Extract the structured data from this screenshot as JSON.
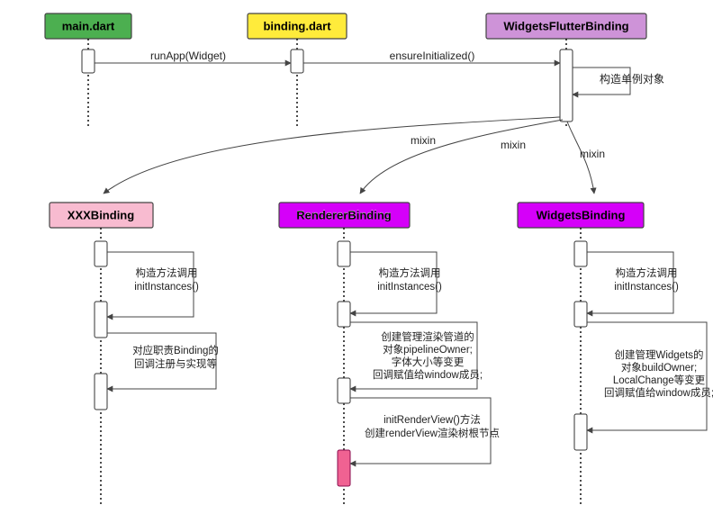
{
  "participants": {
    "main": {
      "label": "main.dart",
      "fill": "#4CAF50"
    },
    "binding": {
      "label": "binding.dart",
      "fill": "#FFEB3B"
    },
    "wfb": {
      "label": "WidgetsFlutterBinding",
      "fill": "#CE93D8"
    },
    "xxx": {
      "label": "XXXBinding",
      "fill": "#F8BBD0"
    },
    "renderer": {
      "label": "RendererBinding",
      "fill": "#D500F9"
    },
    "widgets": {
      "label": "WidgetsBinding",
      "fill": "#D500F9"
    }
  },
  "messages": {
    "runApp": "runApp(Widget)",
    "ensureInit": "ensureInitialized()",
    "constructSingleton": "构造单例对象",
    "mixin": "mixin",
    "initInstances1": "构造方法调用",
    "initInstances2": "initInstances()",
    "xxxResp1": "对应职责Binding的",
    "xxxResp2": "回调注册与实现等",
    "rendererBody1": "创建管理渲染管道的",
    "rendererBody2": "对象pipelineOwner;",
    "rendererBody3": "字体大小等变更",
    "rendererBody4": "回调赋值给window成员;",
    "initRenderView1": "initRenderView()方法",
    "initRenderView2": "创建renderView渲染树根节点",
    "widgetsBody1": "创建管理Widgets的",
    "widgetsBody2": "对象buildOwner;",
    "widgetsBody3": "LocalChange等变更",
    "widgetsBody4": "回调赋值给window成员;"
  }
}
